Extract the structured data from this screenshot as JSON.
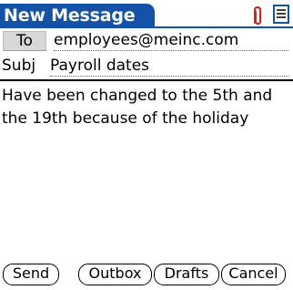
{
  "titlebar": {
    "title": "New Message",
    "icons": [
      "paperclip-icon",
      "menu-document-icon"
    ],
    "accent_color": "#1452a8",
    "paperclip_color": "#d32020"
  },
  "header": {
    "to_label": "To",
    "to_value": "employees@meinc.com",
    "subj_label": "Subj",
    "subj_value": "Payroll dates"
  },
  "body": {
    "text": "Have been changed to the 5th and the 19th because of the holiday"
  },
  "buttons": {
    "send": "Send",
    "outbox": "Outbox",
    "drafts": "Drafts",
    "cancel": "Cancel"
  }
}
